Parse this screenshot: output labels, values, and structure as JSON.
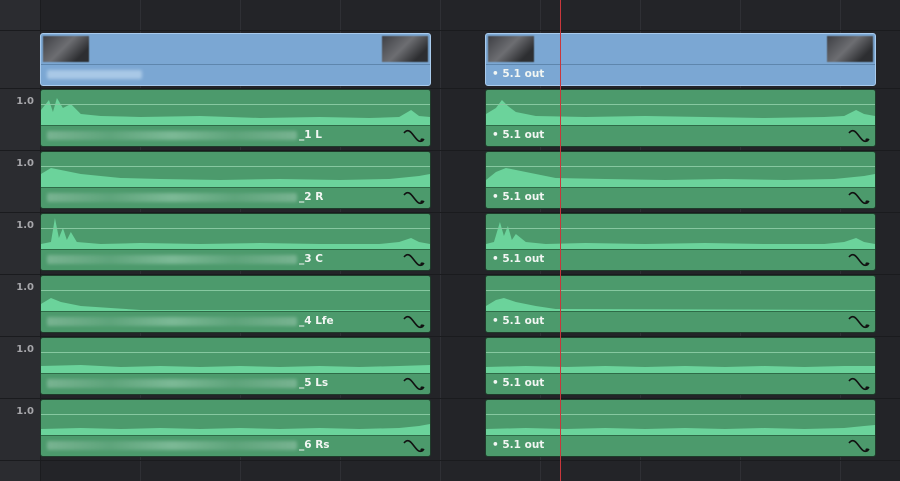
{
  "tracks": [
    {
      "gain": "",
      "type": "video",
      "left_label": "",
      "right_label": "• 5.1 out"
    },
    {
      "gain": "1.0",
      "type": "audio",
      "left_label": "_1 L",
      "right_label": "• 5.1 out"
    },
    {
      "gain": "1.0",
      "type": "audio",
      "left_label": "_2 R",
      "right_label": "• 5.1 out"
    },
    {
      "gain": "1.0",
      "type": "audio",
      "left_label": "_3 C",
      "right_label": "• 5.1 out"
    },
    {
      "gain": "1.0",
      "type": "audio",
      "left_label": "_4 Lfe",
      "right_label": "• 5.1 out"
    },
    {
      "gain": "1.0",
      "type": "audio",
      "left_label": "_5 Ls",
      "right_label": "• 5.1 out"
    },
    {
      "gain": "1.0",
      "type": "audio",
      "left_label": "_6 Rs",
      "right_label": "• 5.1 out"
    }
  ],
  "colors": {
    "audio_clip": "#4c9a6c",
    "video_clip": "#7ba7d3",
    "playhead": "#c8373c",
    "waveform": "#6bd39b"
  },
  "icons": {
    "fx": "curve-fx-icon"
  }
}
